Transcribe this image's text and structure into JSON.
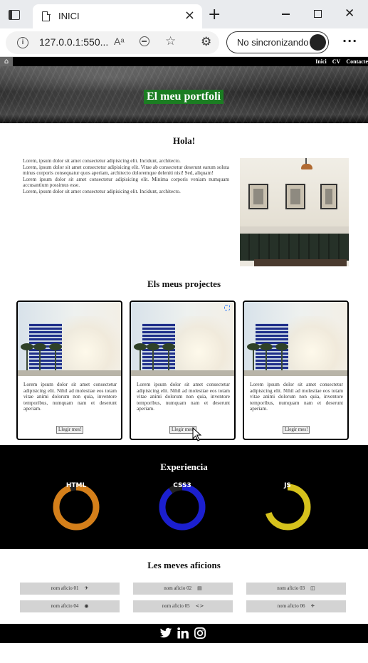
{
  "browser": {
    "tab_title": "INICI",
    "url": "127.0.0.1:550...",
    "read_aloud": "Aᵃ",
    "sync_label": "No sincronizando"
  },
  "site": {
    "nav": [
      "Inici",
      "CV",
      "Contacte"
    ],
    "hero_title": "El meu portfoli",
    "intro": {
      "title": "Hola!",
      "paragraphs": [
        "Lorem, ipsum dolor sit amet consectetur adipisicing elit. Incidunt, architecto.",
        "Lorem, ipsum dolor sit amet consectetur adipisicing elit. Vitae ab consectetur deserunt earum soluta minus corporis consequatur quos aperiam, architecto doloremque deleniti nisi! Sed, aliquam!",
        "Lorem ipsum dolor sit amet consectetur adipisicing elit. Minima corporis veniam numquam accusantium possimus esse.",
        "Lorem, ipsum dolor sit amet consectetur adipisicing elit. Incidunt, architecto."
      ]
    },
    "projects": {
      "title": "Els meus projectes",
      "cards": [
        {
          "text": "Lorem ipsum dolor sit amet consectetur adipisicing elit. Nihil ad molestiae eos totam vitae animi dolorum non quia, inventore temporibus, numquam nam et deserunt aperiam.",
          "button": "Llegir mes!"
        },
        {
          "text": "Lorem ipsum dolor sit amet consectetur adipisicing elit. Nihil ad molestiae eos totam vitae animi dolorum non quia, inventore temporibus, numquam nam et deserunt aperiam.",
          "button": "Llegir mes!"
        },
        {
          "text": "Lorem ipsum dolor sit amet consectetur adipisicing elit. Nihil ad molestiae eos totam vitae animi dolorum non quia, inventore temporibus, numquam nam et deserunt aperiam.",
          "button": "Llegir mes!"
        }
      ]
    },
    "experience": {
      "title": "Experiencia",
      "skills": [
        {
          "name": "HTML",
          "color": "#d47f1a",
          "level": 0.95
        },
        {
          "name": "CSS3",
          "color": "#1b1fcf",
          "level": 0.9
        },
        {
          "name": "JS",
          "color": "#d6c21c",
          "level": 0.7
        }
      ]
    },
    "hobbies": {
      "title": "Les meves aficions",
      "items": [
        {
          "label": "nom aficio 01",
          "icon": "plane-icon",
          "glyph": "✈"
        },
        {
          "label": "nom aficio 02",
          "icon": "document-icon",
          "glyph": "▤"
        },
        {
          "label": "nom aficio 03",
          "icon": "book-icon",
          "glyph": "◫"
        },
        {
          "label": "nom aficio 04",
          "icon": "camera-icon",
          "glyph": "◉"
        },
        {
          "label": "nom aficio 05",
          "icon": "code-icon",
          "glyph": "<>"
        },
        {
          "label": "nom aficio 06",
          "icon": "plane-icon",
          "glyph": "✈"
        }
      ]
    },
    "footer": {
      "social": [
        "twitter-icon",
        "linkedin-icon",
        "instagram-icon"
      ]
    }
  }
}
